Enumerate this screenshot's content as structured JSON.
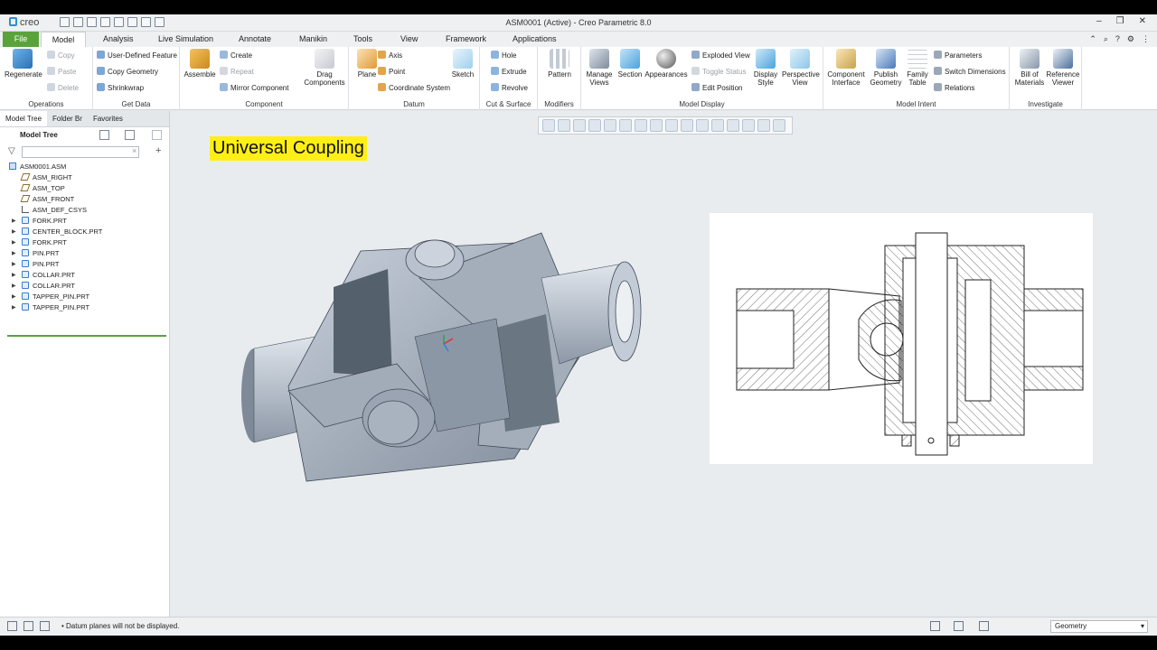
{
  "window": {
    "app_name": "creo",
    "title": "ASM0001 (Active) - Creo Parametric 8.0"
  },
  "menu_tabs": [
    "File",
    "Model",
    "Analysis",
    "Live Simulation",
    "Annotate",
    "Manikin",
    "Tools",
    "View",
    "Framework",
    "Applications"
  ],
  "ribbon": {
    "operations": {
      "label": "Operations",
      "regenerate": "Regenerate",
      "copy": "Copy",
      "paste": "Paste",
      "delete": "Delete"
    },
    "get_data": {
      "label": "Get Data",
      "udf": "User-Defined Feature",
      "copy_geometry": "Copy Geometry",
      "shrinkwrap": "Shrinkwrap"
    },
    "component": {
      "label": "Component",
      "assemble": "Assemble",
      "create": "Create",
      "repeat": "Repeat",
      "mirror": "Mirror Component",
      "drag": "Drag Components"
    },
    "datum": {
      "label": "Datum",
      "plane": "Plane",
      "axis": "Axis",
      "point": "Point",
      "csys": "Coordinate System",
      "sketch": "Sketch"
    },
    "cut_surface": {
      "label": "Cut & Surface",
      "hole": "Hole",
      "extrude": "Extrude",
      "revolve": "Revolve"
    },
    "modifiers": {
      "label": "Modifiers",
      "pattern": "Pattern"
    },
    "model_display": {
      "label": "Model Display",
      "manage_views": "Manage Views",
      "section": "Section",
      "appearances": "Appearances",
      "exploded": "Exploded View",
      "toggle_status": "Toggle Status",
      "edit_position": "Edit Position",
      "display_style": "Display Style",
      "perspective": "Perspective View"
    },
    "model_intent": {
      "label": "Model Intent",
      "component_interface": "Component Interface",
      "publish_geometry": "Publish Geometry",
      "family_table": "Family Table",
      "parameters": "Parameters",
      "switch_dimensions": "Switch Dimensions",
      "relations": "Relations"
    },
    "investigate": {
      "label": "Investigate",
      "bom": "Bill of Materials",
      "reference_viewer": "Reference Viewer"
    }
  },
  "sidebar": {
    "tabs": [
      "Model Tree",
      "Folder Br",
      "Favorites"
    ],
    "header": "Model Tree",
    "tree": [
      {
        "label": "ASM0001.ASM",
        "type": "asm"
      },
      {
        "label": "ASM_RIGHT",
        "type": "plane"
      },
      {
        "label": "ASM_TOP",
        "type": "plane"
      },
      {
        "label": "ASM_FRONT",
        "type": "plane"
      },
      {
        "label": "ASM_DEF_CSYS",
        "type": "csys"
      },
      {
        "label": "FORK.PRT",
        "type": "part"
      },
      {
        "label": "CENTER_BLOCK.PRT",
        "type": "part"
      },
      {
        "label": "FORK.PRT",
        "type": "part"
      },
      {
        "label": "PIN.PRT",
        "type": "part"
      },
      {
        "label": "PIN.PRT",
        "type": "part"
      },
      {
        "label": "COLLAR.PRT",
        "type": "part"
      },
      {
        "label": "COLLAR.PRT",
        "type": "part"
      },
      {
        "label": "TAPPER_PIN.PRT",
        "type": "part"
      },
      {
        "label": "TAPPER_PIN.PRT",
        "type": "part"
      }
    ]
  },
  "canvas": {
    "title": "Universal Coupling"
  },
  "status": {
    "message": "• Datum planes will not be displayed.",
    "filter": "Geometry"
  },
  "colors": {
    "file_tab": "#5aa33a",
    "highlight": "#ffef16",
    "model_fill": "#a9b3c2"
  }
}
